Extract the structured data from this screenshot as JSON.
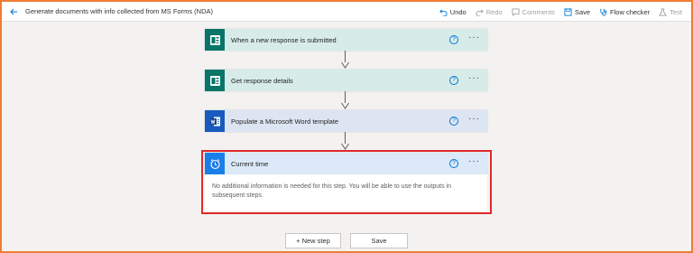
{
  "header": {
    "title": "Generate documents with info collected from MS Forms (NDA)",
    "undo_label": "Undo",
    "redo_label": "Redo",
    "comments_label": "Comments",
    "save_label": "Save",
    "flow_checker_label": "Flow checker",
    "test_label": "Test"
  },
  "steps": [
    {
      "title": "When a new response is submitted",
      "icon": "ms-forms-icon"
    },
    {
      "title": "Get response details",
      "icon": "ms-forms-icon"
    },
    {
      "title": "Populate a Microsoft Word template",
      "icon": "word-icon"
    },
    {
      "title": "Current time",
      "icon": "clock-icon",
      "body": "No additional information is needed for this step. You will be able to use the outputs in subsequent steps."
    }
  ],
  "help_glyph": "?",
  "more_glyph": "···",
  "footer": {
    "new_step_label": "+ New step",
    "save_label": "Save"
  },
  "colors": {
    "accent": "#0078d4",
    "forms_header": "#d7ece9",
    "forms_icon": "#077568",
    "word_header": "#dde5f3",
    "word_icon": "#185abd",
    "time_header": "#dbe9f8",
    "time_icon": "#1a7ee8",
    "highlight_border": "#e02a2a",
    "frame_border": "#f07c33"
  }
}
